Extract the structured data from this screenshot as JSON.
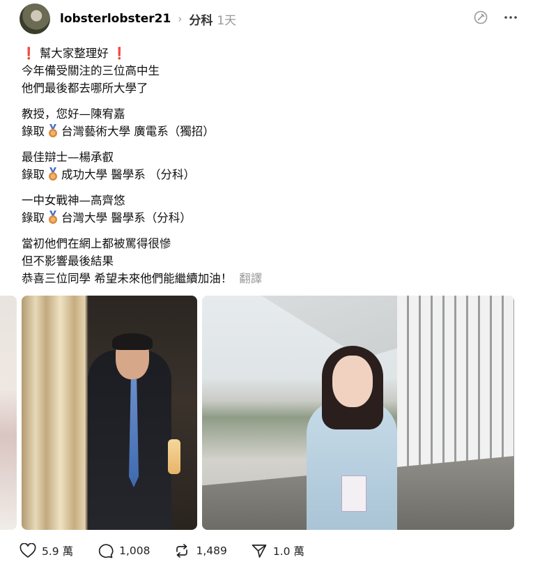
{
  "header": {
    "username": "lobsterlobster21",
    "separator": "›",
    "topic": "分科",
    "time": "1天",
    "icons": [
      "avatar",
      "chevron-right-icon",
      "stamp-icon",
      "more-icon"
    ]
  },
  "post": {
    "title_line": "幫大家整理好",
    "intro_lines": [
      "今年備受關注的三位高中生",
      "他們最後都去哪所大學了"
    ],
    "entries": [
      {
        "title": "教授，您好—陳宥嘉",
        "prefix": "錄取",
        "detail": "台灣藝術大學 廣電系（獨招）"
      },
      {
        "title": "最佳辯士—楊承叡",
        "prefix": "錄取",
        "detail": "成功大學 醫學系 （分科）"
      },
      {
        "title": "一中女戰神—高齊悠",
        "prefix": "錄取",
        "detail": "台灣大學 醫學系（分科）"
      }
    ],
    "closing_lines": [
      "當初他們在網上都被罵得很慘",
      "但不影響最後結果",
      "恭喜三位同學 希望未來他們能繼續加油！"
    ],
    "translate_label": "翻譯"
  },
  "actions": {
    "likes": "5.9 萬",
    "comments": "1,008",
    "reposts": "1,489",
    "shares": "1.0 萬"
  },
  "colors": {
    "exclamation": "#e0262b",
    "muted": "#999999",
    "text": "#111111"
  }
}
